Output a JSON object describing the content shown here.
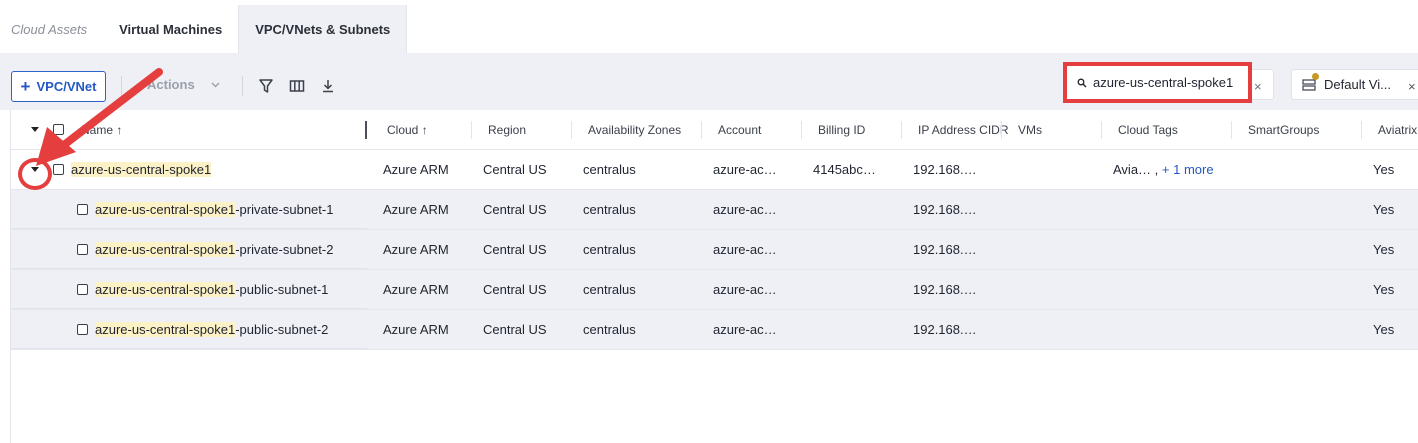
{
  "tabs": [
    {
      "label": "Cloud Assets"
    },
    {
      "label": "Virtual Machines"
    },
    {
      "label": "VPC/VNets & Subnets"
    }
  ],
  "toolbar": {
    "add_label": "VPC/VNet",
    "actions_label": "Actions"
  },
  "search": {
    "value": "azure-us-central-spoke1",
    "clear": "×"
  },
  "view": {
    "label": "Default Vi...",
    "close": "×"
  },
  "columns": [
    "Name",
    "Cloud",
    "Region",
    "Availability Zones",
    "Account",
    "Billing ID",
    "IP Address CIDR",
    "VMs",
    "Cloud Tags",
    "SmartGroups",
    "Aviatrix"
  ],
  "parent_row": {
    "name": "azure-us-central-spoke1",
    "cloud": "Azure ARM",
    "region": "Central US",
    "az": "centralus",
    "account": "azure-ac…",
    "billing": "4145abc…",
    "cidr": "192.168.…",
    "tags": "Avia… ,",
    "tags_more": "+ 1 more",
    "aviatrix": "Yes"
  },
  "subnet_rows": [
    {
      "hl": "azure-us-central-spoke1",
      "rest": "-private-subnet-1",
      "cloud": "Azure ARM",
      "region": "Central US",
      "az": "centralus",
      "account": "azure-ac…",
      "cidr": "192.168.…",
      "aviatrix": "Yes"
    },
    {
      "hl": "azure-us-central-spoke1",
      "rest": "-private-subnet-2",
      "cloud": "Azure ARM",
      "region": "Central US",
      "az": "centralus",
      "account": "azure-ac…",
      "cidr": "192.168.…",
      "aviatrix": "Yes"
    },
    {
      "hl": "azure-us-central-spoke1",
      "rest": "-public-subnet-1",
      "cloud": "Azure ARM",
      "region": "Central US",
      "az": "centralus",
      "account": "azure-ac…",
      "cidr": "192.168.…",
      "aviatrix": "Yes"
    },
    {
      "hl": "azure-us-central-spoke1",
      "rest": "-public-subnet-2",
      "cloud": "Azure ARM",
      "region": "Central US",
      "az": "centralus",
      "account": "azure-ac…",
      "cidr": "192.168.…",
      "aviatrix": "Yes"
    }
  ],
  "colors": {
    "accent": "#2357c4",
    "annotation": "#e53e3e",
    "highlight": "#fdf1c6"
  }
}
